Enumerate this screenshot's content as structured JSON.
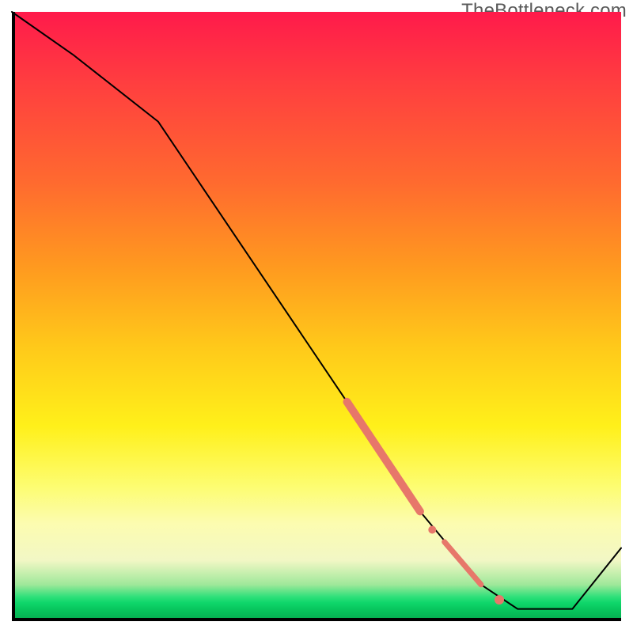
{
  "watermark": "TheBottleneck.com",
  "chart_data": {
    "type": "line",
    "title": "",
    "xlabel": "",
    "ylabel": "",
    "xlim": [
      0,
      100
    ],
    "ylim": [
      0,
      100
    ],
    "grid": false,
    "series": [
      {
        "name": "bottleneck-curve",
        "color": "#000000",
        "stroke_width": 2,
        "x": [
          0,
          10,
          24,
          55,
          62,
          67,
          72,
          77,
          83,
          92,
          100
        ],
        "y": [
          100,
          93,
          82,
          36,
          26,
          18,
          12,
          6,
          2,
          2,
          12
        ]
      }
    ],
    "highlights": [
      {
        "name": "thick-segment",
        "color": "#e7776a",
        "stroke_width": 10,
        "x": [
          55,
          67
        ],
        "y": [
          36,
          18
        ]
      },
      {
        "name": "dash-segment-1",
        "color": "#e7776a",
        "stroke_width": 7,
        "x": [
          71,
          77
        ],
        "y": [
          13,
          6
        ]
      },
      {
        "name": "dot-upper",
        "color": "#e7776a",
        "radius": 5,
        "x": 69,
        "y": 15
      },
      {
        "name": "dot-lower",
        "color": "#e7776a",
        "radius": 6,
        "x": 80,
        "y": 3.5
      }
    ],
    "background_gradient": {
      "stops": [
        {
          "pos": 0.0,
          "color": "#ff1a4b"
        },
        {
          "pos": 0.55,
          "color": "#ffc91a"
        },
        {
          "pos": 0.85,
          "color": "#fcfcb0"
        },
        {
          "pos": 0.96,
          "color": "#2fe07a"
        },
        {
          "pos": 1.0,
          "color": "#05a84e"
        }
      ]
    }
  }
}
